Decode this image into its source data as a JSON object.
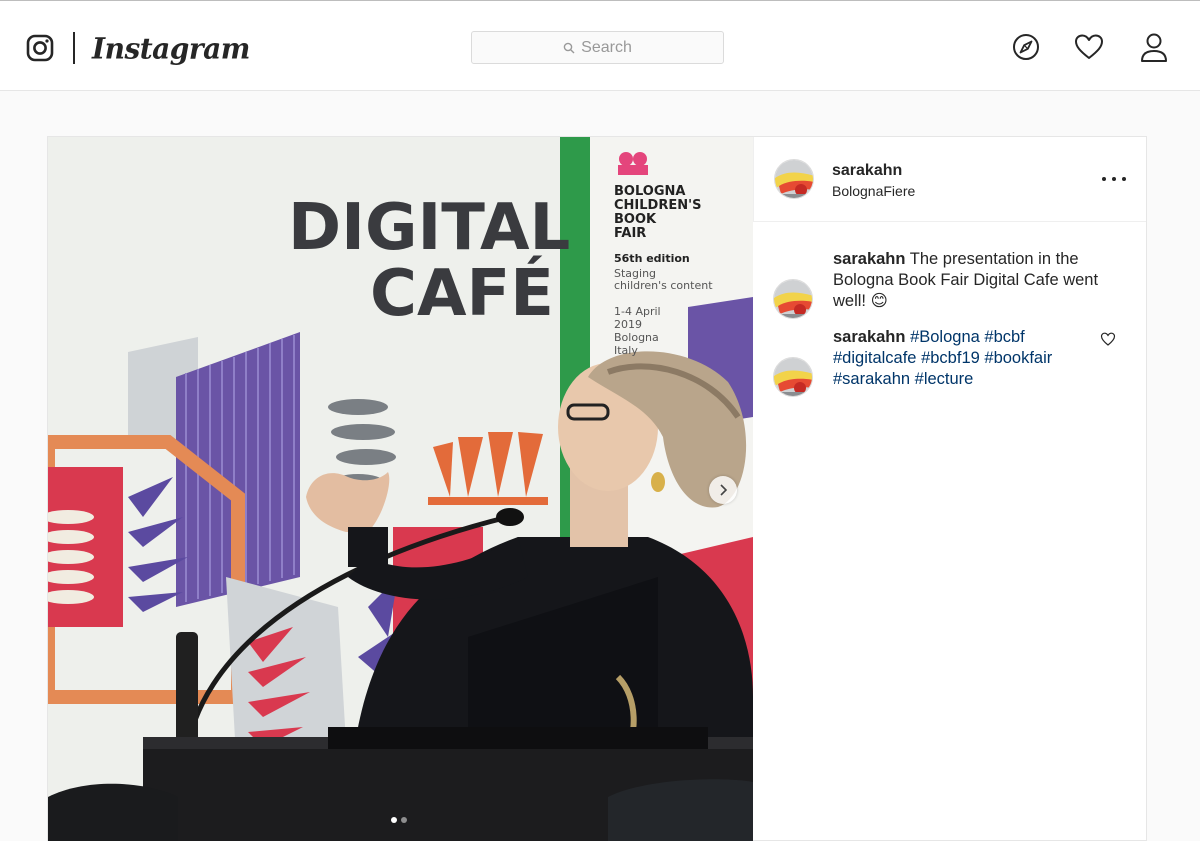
{
  "brand": {
    "wordmark": "Instagram",
    "logo_icon": "instagram-camera-icon"
  },
  "search": {
    "placeholder": "Search",
    "icon": "search-icon"
  },
  "nav": {
    "icons": [
      "compass-icon",
      "heart-icon",
      "profile-icon"
    ]
  },
  "photo": {
    "sign_text": [
      "DIGITAL",
      "CAFÉ"
    ],
    "banner_lines": [
      "BOLOGNA",
      "CHILDREN'S",
      "BOOK",
      "FAIR",
      "56th edition",
      "Staging",
      "children's content",
      "1-4 April",
      "2019",
      "Bologna",
      "Italy"
    ],
    "carousel": {
      "total": 2,
      "active": 1
    }
  },
  "post": {
    "username": "sarakahn",
    "location": "BolognaFiere",
    "caption": {
      "username": "sarakahn",
      "text": "The presentation in the Bologna Book Fair Digital Cafe went well! 😊"
    },
    "comment": {
      "username": "sarakahn",
      "hashtags": [
        "#Bologna",
        "#bcbf",
        "#digitalcafe",
        "#bcbf19",
        "#bookfair",
        "#sarakahn",
        "#lecture"
      ]
    }
  },
  "colors": {
    "link": "#003569",
    "text": "#262626",
    "border": "#dbdbdb",
    "background": "#fafafa"
  }
}
